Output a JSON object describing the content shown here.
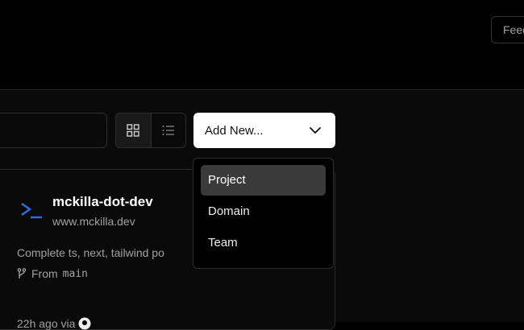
{
  "header": {
    "feedback_label": "Feedback"
  },
  "toolbar": {
    "search_placeholder": "",
    "add_new_label": "Add New..."
  },
  "dropdown": {
    "items": [
      {
        "label": "Project",
        "highlighted": true
      },
      {
        "label": "Domain",
        "highlighted": false
      },
      {
        "label": "Team",
        "highlighted": false
      }
    ]
  },
  "project_card": {
    "name": "mckilla-dot-dev",
    "url": "www.mckilla.dev",
    "description": "Complete ts, next, tailwind po",
    "branch_prefix": "From",
    "branch": "main",
    "updated": "22h ago via"
  },
  "colors": {
    "accent_icon": "#2f6fe0",
    "highlight": "#3a3a3a"
  }
}
